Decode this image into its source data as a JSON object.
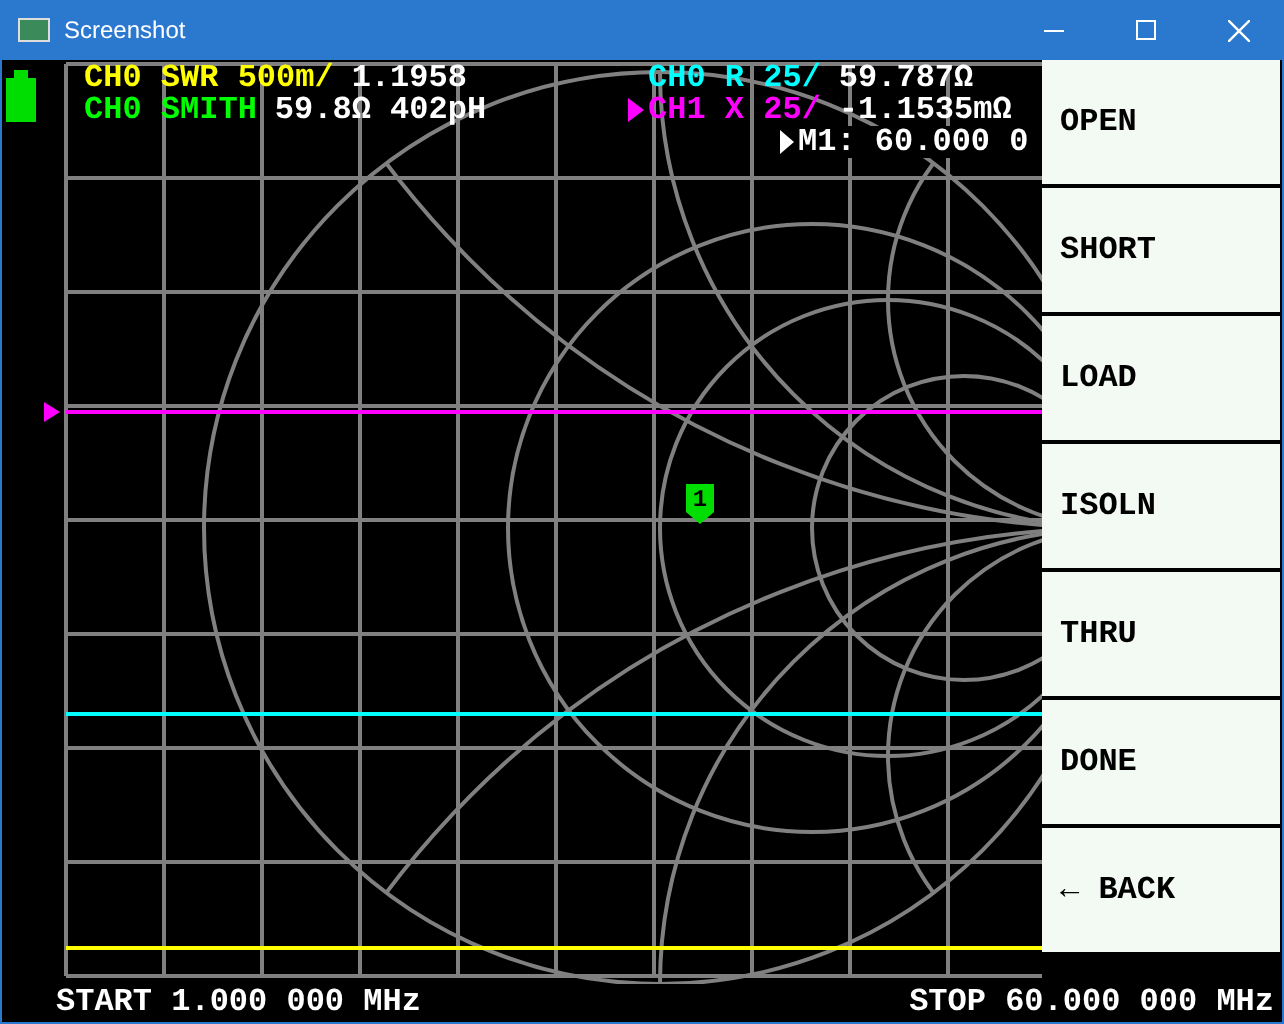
{
  "window": {
    "title": "Screenshot"
  },
  "trace_labels": [
    {
      "label": "CH0 SWR 500m/",
      "value": "1.1958",
      "color": "#ffff00",
      "active": false
    },
    {
      "label": "CH0 SMITH",
      "value": "59.8Ω 402pH",
      "color": "#00ff00",
      "active": false
    },
    {
      "label": "CH0 R 25/",
      "value": "59.787Ω",
      "color": "#00ffff",
      "active": false
    },
    {
      "label": "CH1 X 25/",
      "value": "-1.1535mΩ",
      "color": "#ff00ff",
      "active": true
    }
  ],
  "marker_readout": "M1: 60.000 0",
  "marker": {
    "label": "1"
  },
  "trace_lines": [
    {
      "color": "#ff00ff"
    },
    {
      "color": "#00ffff"
    },
    {
      "color": "#ffff00"
    }
  ],
  "menu": [
    "OPEN",
    "SHORT",
    "LOAD",
    "ISOLN",
    "THRU",
    "DONE",
    "← BACK"
  ],
  "start": "START 1.000 000 MHz",
  "stop": "STOP 60.000 000 MHz"
}
